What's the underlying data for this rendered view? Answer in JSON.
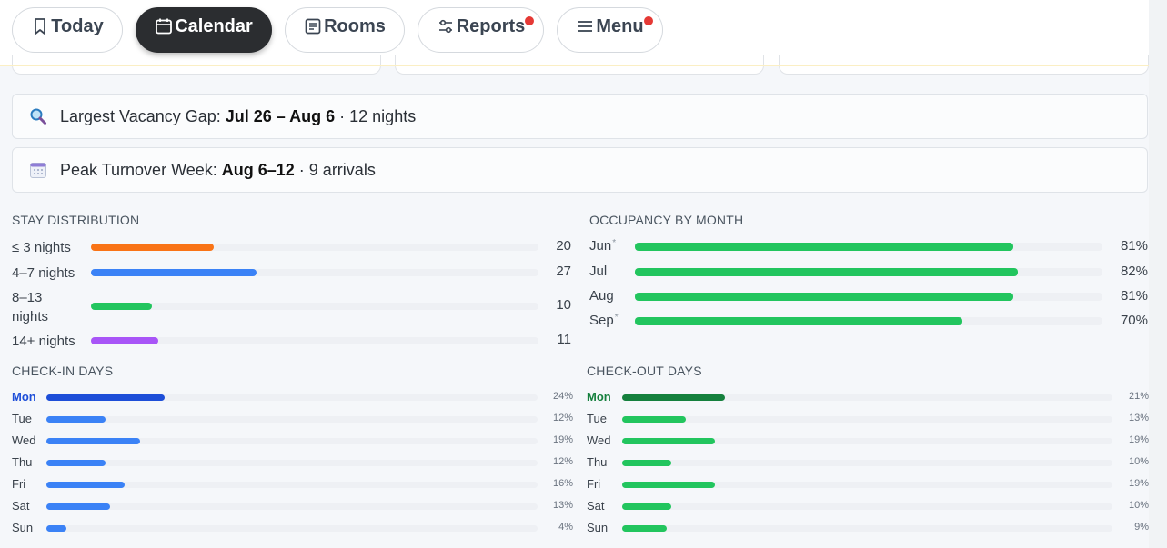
{
  "nav": {
    "tabs": [
      {
        "label": "Today",
        "icon": "bookmark-icon",
        "active": false,
        "badge": false
      },
      {
        "label": "Calendar",
        "icon": "calendar-icon",
        "active": true,
        "badge": false
      },
      {
        "label": "Rooms",
        "icon": "list-icon",
        "active": false,
        "badge": false
      },
      {
        "label": "Reports",
        "icon": "sliders-icon",
        "active": false,
        "badge": true
      },
      {
        "label": "Menu",
        "icon": "hamburger-icon",
        "active": false,
        "badge": true
      }
    ]
  },
  "insights": {
    "vacancy": {
      "icon": "magnifier-icon",
      "prefix": "Largest Vacancy Gap: ",
      "range": "Jul 26 – Aug 6",
      "suffix": " · 12 nights"
    },
    "turnover": {
      "icon": "calendar-grid-icon",
      "prefix": "Peak Turnover Week: ",
      "range": "Aug 6–12",
      "suffix": " · 9 arrivals"
    }
  },
  "stay_distribution": {
    "title": "STAY DISTRIBUTION",
    "max": 73,
    "rows": [
      {
        "label": "≤ 3 nights",
        "value": 20,
        "display": "20",
        "color": "#f97316"
      },
      {
        "label": "4–7 nights",
        "value": 27,
        "display": "27",
        "color": "#3b82f6"
      },
      {
        "label": "8–13 nights",
        "value": 10,
        "display": "10",
        "color": "#22c55e"
      },
      {
        "label": "14+ nights",
        "value": 11,
        "display": "11",
        "color": "#a855f7"
      }
    ]
  },
  "occupancy": {
    "title": "OCCUPANCY BY MONTH",
    "rows": [
      {
        "label": "Jun",
        "mark": "*",
        "value": 81,
        "display": "81%",
        "color": "#22c55e"
      },
      {
        "label": "Jul",
        "mark": "",
        "value": 82,
        "display": "82%",
        "color": "#22c55e"
      },
      {
        "label": "Aug",
        "mark": "",
        "value": 81,
        "display": "81%",
        "color": "#22c55e"
      },
      {
        "label": "Sep",
        "mark": "*",
        "value": 70,
        "display": "70%",
        "color": "#22c55e"
      }
    ]
  },
  "checkin": {
    "title": "CHECK-IN DAYS",
    "max": 100,
    "rows": [
      {
        "label": "Mon",
        "value": 24,
        "display": "24%",
        "highlight": true
      },
      {
        "label": "Tue",
        "value": 12,
        "display": "12%",
        "highlight": false
      },
      {
        "label": "Wed",
        "value": 19,
        "display": "19%",
        "highlight": false
      },
      {
        "label": "Thu",
        "value": 12,
        "display": "12%",
        "highlight": false
      },
      {
        "label": "Fri",
        "value": 16,
        "display": "16%",
        "highlight": false
      },
      {
        "label": "Sat",
        "value": 13,
        "display": "13%",
        "highlight": false
      },
      {
        "label": "Sun",
        "value": 4,
        "display": "4%",
        "highlight": false
      }
    ],
    "colors": {
      "normal": "#3b82f6",
      "highlight": "#1d4ed8"
    }
  },
  "checkout": {
    "title": "CHECK-OUT DAYS",
    "max": 100,
    "rows": [
      {
        "label": "Mon",
        "value": 21,
        "display": "21%",
        "highlight": true
      },
      {
        "label": "Tue",
        "value": 13,
        "display": "13%",
        "highlight": false
      },
      {
        "label": "Wed",
        "value": 19,
        "display": "19%",
        "highlight": false
      },
      {
        "label": "Thu",
        "value": 10,
        "display": "10%",
        "highlight": false
      },
      {
        "label": "Fri",
        "value": 19,
        "display": "19%",
        "highlight": false
      },
      {
        "label": "Sat",
        "value": 10,
        "display": "10%",
        "highlight": false
      },
      {
        "label": "Sun",
        "value": 9,
        "display": "9%",
        "highlight": false
      }
    ],
    "colors": {
      "normal": "#22c55e",
      "highlight": "#15803d"
    }
  }
}
